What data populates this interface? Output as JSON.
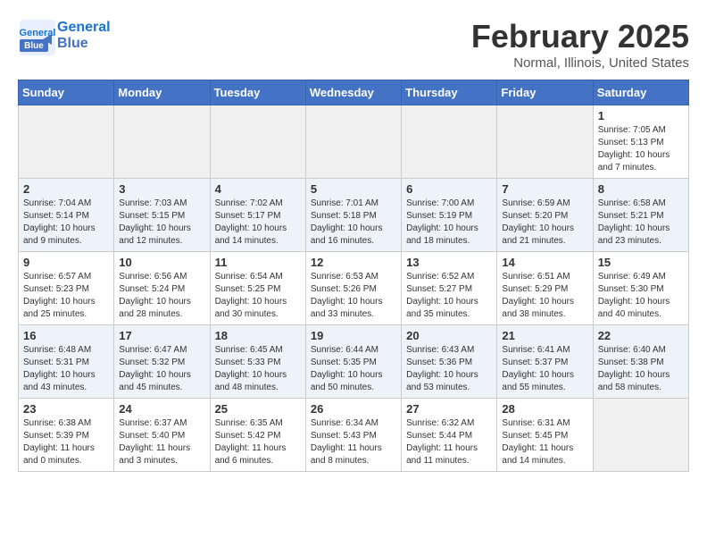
{
  "header": {
    "logo_line1": "General",
    "logo_line2": "Blue",
    "month": "February 2025",
    "location": "Normal, Illinois, United States"
  },
  "weekdays": [
    "Sunday",
    "Monday",
    "Tuesday",
    "Wednesday",
    "Thursday",
    "Friday",
    "Saturday"
  ],
  "weeks": [
    [
      {
        "day": "",
        "info": ""
      },
      {
        "day": "",
        "info": ""
      },
      {
        "day": "",
        "info": ""
      },
      {
        "day": "",
        "info": ""
      },
      {
        "day": "",
        "info": ""
      },
      {
        "day": "",
        "info": ""
      },
      {
        "day": "1",
        "info": "Sunrise: 7:05 AM\nSunset: 5:13 PM\nDaylight: 10 hours\nand 7 minutes."
      }
    ],
    [
      {
        "day": "2",
        "info": "Sunrise: 7:04 AM\nSunset: 5:14 PM\nDaylight: 10 hours\nand 9 minutes."
      },
      {
        "day": "3",
        "info": "Sunrise: 7:03 AM\nSunset: 5:15 PM\nDaylight: 10 hours\nand 12 minutes."
      },
      {
        "day": "4",
        "info": "Sunrise: 7:02 AM\nSunset: 5:17 PM\nDaylight: 10 hours\nand 14 minutes."
      },
      {
        "day": "5",
        "info": "Sunrise: 7:01 AM\nSunset: 5:18 PM\nDaylight: 10 hours\nand 16 minutes."
      },
      {
        "day": "6",
        "info": "Sunrise: 7:00 AM\nSunset: 5:19 PM\nDaylight: 10 hours\nand 18 minutes."
      },
      {
        "day": "7",
        "info": "Sunrise: 6:59 AM\nSunset: 5:20 PM\nDaylight: 10 hours\nand 21 minutes."
      },
      {
        "day": "8",
        "info": "Sunrise: 6:58 AM\nSunset: 5:21 PM\nDaylight: 10 hours\nand 23 minutes."
      }
    ],
    [
      {
        "day": "9",
        "info": "Sunrise: 6:57 AM\nSunset: 5:23 PM\nDaylight: 10 hours\nand 25 minutes."
      },
      {
        "day": "10",
        "info": "Sunrise: 6:56 AM\nSunset: 5:24 PM\nDaylight: 10 hours\nand 28 minutes."
      },
      {
        "day": "11",
        "info": "Sunrise: 6:54 AM\nSunset: 5:25 PM\nDaylight: 10 hours\nand 30 minutes."
      },
      {
        "day": "12",
        "info": "Sunrise: 6:53 AM\nSunset: 5:26 PM\nDaylight: 10 hours\nand 33 minutes."
      },
      {
        "day": "13",
        "info": "Sunrise: 6:52 AM\nSunset: 5:27 PM\nDaylight: 10 hours\nand 35 minutes."
      },
      {
        "day": "14",
        "info": "Sunrise: 6:51 AM\nSunset: 5:29 PM\nDaylight: 10 hours\nand 38 minutes."
      },
      {
        "day": "15",
        "info": "Sunrise: 6:49 AM\nSunset: 5:30 PM\nDaylight: 10 hours\nand 40 minutes."
      }
    ],
    [
      {
        "day": "16",
        "info": "Sunrise: 6:48 AM\nSunset: 5:31 PM\nDaylight: 10 hours\nand 43 minutes."
      },
      {
        "day": "17",
        "info": "Sunrise: 6:47 AM\nSunset: 5:32 PM\nDaylight: 10 hours\nand 45 minutes."
      },
      {
        "day": "18",
        "info": "Sunrise: 6:45 AM\nSunset: 5:33 PM\nDaylight: 10 hours\nand 48 minutes."
      },
      {
        "day": "19",
        "info": "Sunrise: 6:44 AM\nSunset: 5:35 PM\nDaylight: 10 hours\nand 50 minutes."
      },
      {
        "day": "20",
        "info": "Sunrise: 6:43 AM\nSunset: 5:36 PM\nDaylight: 10 hours\nand 53 minutes."
      },
      {
        "day": "21",
        "info": "Sunrise: 6:41 AM\nSunset: 5:37 PM\nDaylight: 10 hours\nand 55 minutes."
      },
      {
        "day": "22",
        "info": "Sunrise: 6:40 AM\nSunset: 5:38 PM\nDaylight: 10 hours\nand 58 minutes."
      }
    ],
    [
      {
        "day": "23",
        "info": "Sunrise: 6:38 AM\nSunset: 5:39 PM\nDaylight: 11 hours\nand 0 minutes."
      },
      {
        "day": "24",
        "info": "Sunrise: 6:37 AM\nSunset: 5:40 PM\nDaylight: 11 hours\nand 3 minutes."
      },
      {
        "day": "25",
        "info": "Sunrise: 6:35 AM\nSunset: 5:42 PM\nDaylight: 11 hours\nand 6 minutes."
      },
      {
        "day": "26",
        "info": "Sunrise: 6:34 AM\nSunset: 5:43 PM\nDaylight: 11 hours\nand 8 minutes."
      },
      {
        "day": "27",
        "info": "Sunrise: 6:32 AM\nSunset: 5:44 PM\nDaylight: 11 hours\nand 11 minutes."
      },
      {
        "day": "28",
        "info": "Sunrise: 6:31 AM\nSunset: 5:45 PM\nDaylight: 11 hours\nand 14 minutes."
      },
      {
        "day": "",
        "info": ""
      }
    ]
  ]
}
